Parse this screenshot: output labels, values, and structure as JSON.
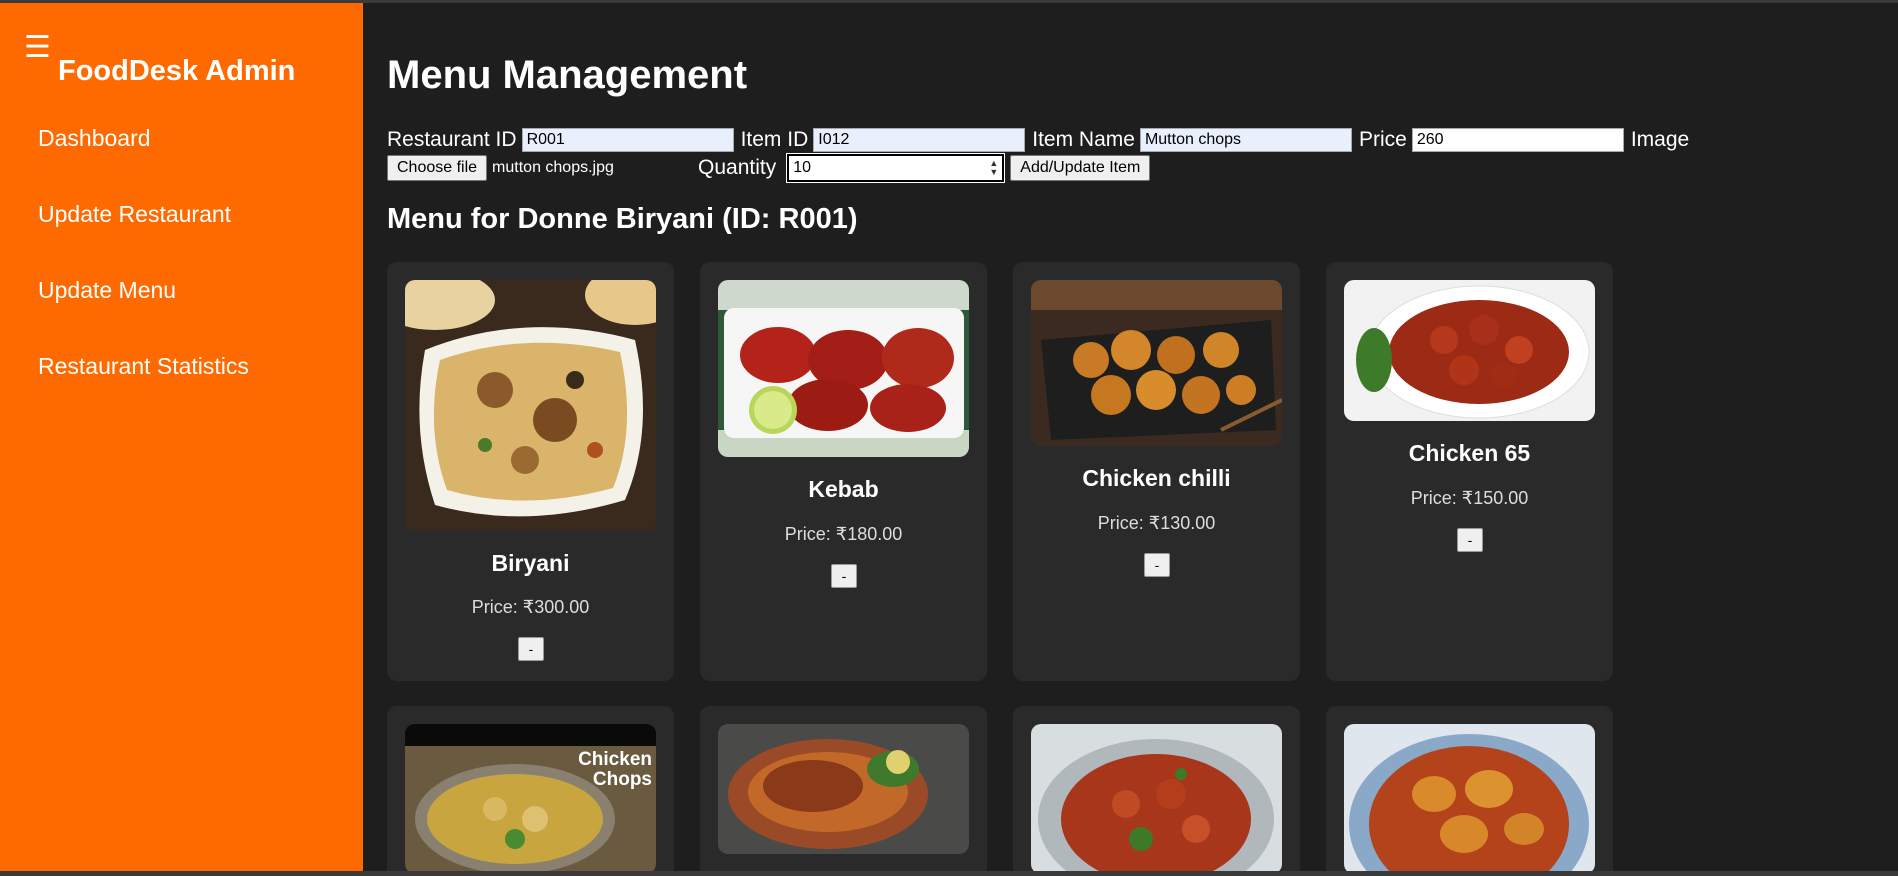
{
  "sidebar": {
    "menu_icon": "hamburger-icon",
    "brand": "FoodDesk Admin",
    "items": [
      {
        "label": "Dashboard"
      },
      {
        "label": "Update Restaurant"
      },
      {
        "label": "Update Menu"
      },
      {
        "label": "Restaurant Statistics"
      }
    ]
  },
  "page": {
    "title": "Menu Management",
    "menu_heading": "Menu for Donne Biryani (ID: R001)"
  },
  "form": {
    "restaurant_id_label": "Restaurant ID",
    "restaurant_id_value": "R001",
    "item_id_label": "Item ID",
    "item_id_value": "I012",
    "item_name_label": "Item Name",
    "item_name_value": "Mutton chops",
    "price_label": "Price",
    "price_value": "260",
    "image_label": "Image",
    "choose_file_label": "Choose file",
    "file_name": "mutton chops.jpg",
    "quantity_label": "Quantity",
    "quantity_value": "10",
    "submit_label": "Add/Update Item"
  },
  "menu_items": [
    {
      "name": "Biryani",
      "price": "Price: ₹300.00",
      "remove_label": "-"
    },
    {
      "name": "Kebab",
      "price": "Price: ₹180.00",
      "remove_label": "-"
    },
    {
      "name": "Chicken chilli",
      "price": "Price: ₹130.00",
      "remove_label": "-"
    },
    {
      "name": "Chicken 65",
      "price": "Price: ₹150.00",
      "remove_label": "-"
    }
  ],
  "second_row_overlay": {
    "chops_caption": "Chicken Chops"
  },
  "colors": {
    "sidebar": "#ff6a00",
    "background": "#1e1e1e",
    "card": "#2a2a2a"
  }
}
